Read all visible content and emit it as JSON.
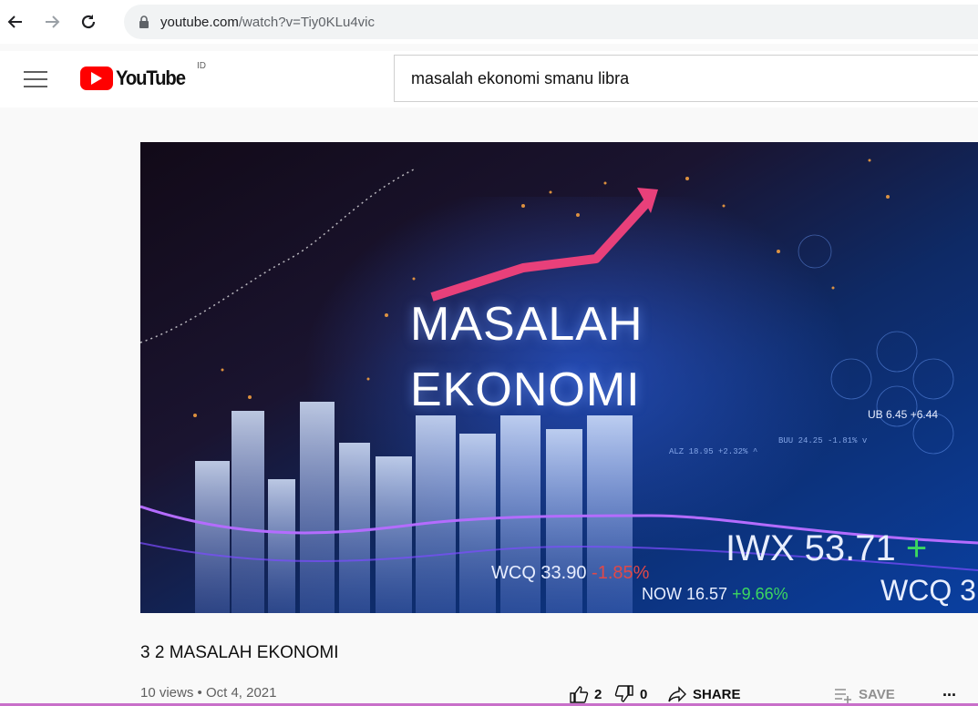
{
  "browser": {
    "url_host": "youtube.com",
    "url_path": "/watch?v=Tiy0KLu4vic"
  },
  "header": {
    "logo_text": "YouTube",
    "region": "ID",
    "search_query": "masalah ekonomi smanu libra"
  },
  "thumbnail": {
    "line1": "MASALAH",
    "line2": "EKONOMI",
    "ticker_big": "IWX 53.71",
    "ticker_big_change": "+",
    "ticker_mid": "WCQ 33.90",
    "ticker_mid_change": "-1.85%",
    "ticker_now": "NOW 16.57",
    "ticker_now_change": "+9.66%",
    "ticker_wcq": "WCQ 3",
    "ticker_ub": "UB 6.45 +6.44"
  },
  "video": {
    "title": "3 2 MASALAH EKONOMI",
    "stats": "10 views • Oct 4, 2021",
    "likes": "2",
    "dislikes": "0",
    "share_label": "SHARE",
    "save_label": "SAVE",
    "more_label": "..."
  },
  "colors": {
    "brand_red": "#ff0000",
    "accent_pink": "#e8407a"
  }
}
